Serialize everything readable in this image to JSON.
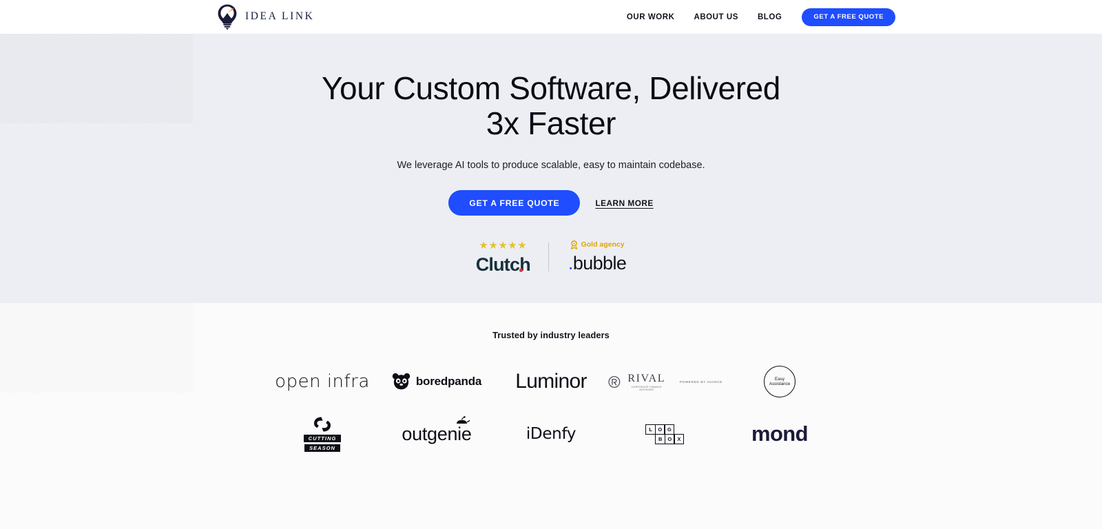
{
  "header": {
    "brand": {
      "name": "IDEA LINK",
      "icon": "lightbulb-idea-icon"
    },
    "nav": [
      {
        "label": "OUR WORK",
        "name": "nav-our-work"
      },
      {
        "label": "ABOUT US",
        "name": "nav-about-us"
      },
      {
        "label": "BLOG",
        "name": "nav-blog"
      }
    ],
    "cta_label": "GET A FREE QUOTE"
  },
  "hero": {
    "title_line1": "Your Custom Software, Delivered",
    "title_line2": "3x Faster",
    "subtitle": "We leverage AI tools to produce scalable, easy to maintain codebase.",
    "primary_cta": "GET A FREE QUOTE",
    "secondary_cta": "LEARN MORE",
    "badges": {
      "clutch": {
        "stars": "★★★★★",
        "star_count": 5,
        "name": "Clutch"
      },
      "bubble": {
        "tier": "Gold agency",
        "dot": ".",
        "name": "bubble",
        "medal_icon": "medal-icon"
      }
    }
  },
  "logos": {
    "heading": "Trusted by industry leaders",
    "row1": [
      {
        "name": "open infra"
      },
      {
        "name": "boredpanda",
        "icon": "panda-face-icon"
      },
      {
        "name": "Luminor"
      },
      {
        "name": "RIVAL",
        "sub": "CORPORATE FINANCE ADVISORS",
        "tagline": "POWERED BY AVANCE",
        "icon": "rival-circle-icon"
      },
      {
        "name_line1": "Easy",
        "name_line2": "Assistance"
      }
    ],
    "row2": [
      {
        "name_line1": "CUTTING",
        "name_line2": "SEASON",
        "icon": "cs-monogram-icon"
      },
      {
        "name": "outgenie",
        "icon": "genie-lamp-icon"
      },
      {
        "name": "iDenfy"
      },
      {
        "top": [
          "L",
          "O",
          "G"
        ],
        "bottom": [
          "B",
          "O",
          "X"
        ]
      },
      {
        "name": "mond"
      }
    ]
  },
  "colors": {
    "accent_blue": "#1f4dff",
    "hero_bg": "#eceef3",
    "gold": "#e3c230",
    "navy": "#1c1b3a"
  }
}
